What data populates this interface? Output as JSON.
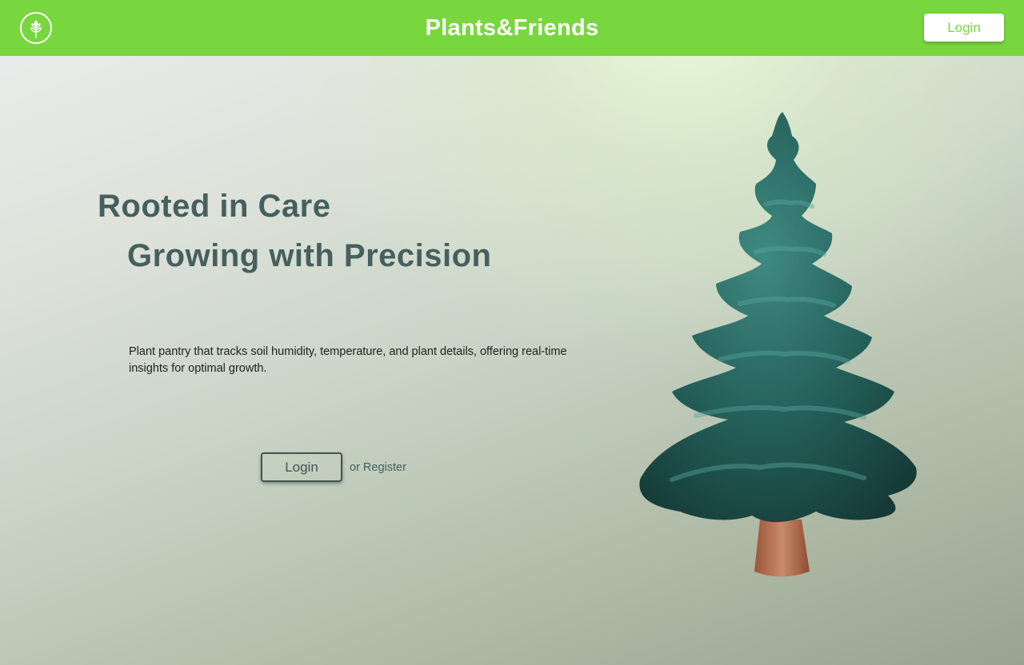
{
  "header": {
    "brand": "Plants&Friends",
    "login_label": "Login",
    "logo_icon": "leaf-sprout-icon"
  },
  "hero": {
    "headline_line1": "Rooted in Care",
    "headline_line2": "Growing with Precision",
    "description": "Plant pantry that tracks soil humidity, temperature, and plant details, offering real-time insights for optimal growth.",
    "login_label": "Login",
    "register_label": "or Register",
    "illustration": "pine-tree-illustration"
  },
  "colors": {
    "brand_green": "#78d63f",
    "heading_slate": "#45605e",
    "tree_foliage": "#1f5a54",
    "tree_trunk": "#b56c4c"
  }
}
